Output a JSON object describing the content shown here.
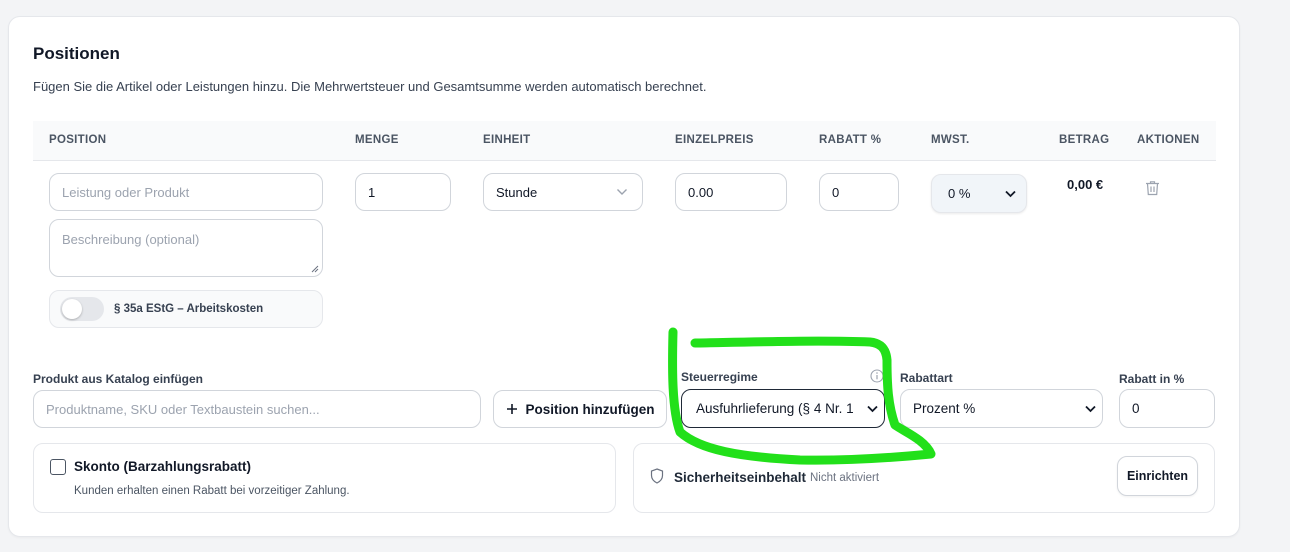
{
  "section": {
    "title": "Positionen",
    "subtitle": "Fügen Sie die Artikel oder Leistungen hinzu. Die Mehrwertsteuer und Gesamtsumme werden automatisch berechnet."
  },
  "table": {
    "headers": [
      "POSITION",
      "MENGE",
      "EINHEIT",
      "EINZELPREIS",
      "RABATT %",
      "MWST.",
      "BETRAG",
      "AKTIONEN"
    ],
    "row": {
      "position_placeholder": "Leistung oder Produkt",
      "beschreibung_placeholder": "Beschreibung (optional)",
      "menge": "1",
      "einheit": "Stunde",
      "einzelpreis": "0.00",
      "rabatt": "0",
      "mwst": "0 %",
      "betrag": "0,00 €",
      "toggle_label": "§ 35a EStG – Arbeitskosten",
      "toggle_on": false
    }
  },
  "catalog": {
    "label": "Produkt aus Katalog einfügen",
    "placeholder": "Produktname, SKU oder Textbaustein suchen...",
    "add_button": "Position hinzufügen"
  },
  "steuerregime": {
    "label": "Steuerregime",
    "value": "Ausfuhrlieferung (§ 4 Nr. 1"
  },
  "rabattart": {
    "label": "Rabattart",
    "value": "Prozent %"
  },
  "rabatt_prozent": {
    "label": "Rabatt in %",
    "value": "0"
  },
  "skonto": {
    "title": "Skonto (Barzahlungsrabatt)",
    "description": "Kunden erhalten einen Rabatt bei vorzeitiger Zahlung.",
    "checked": false
  },
  "sicherheitseinbehalt": {
    "title": "Sicherheitseinbehalt",
    "status": "Nicht aktiviert",
    "button": "Einrichten"
  },
  "colors": {
    "highlight": "#22e01a",
    "border": "#d1d5db",
    "text": "#111827"
  }
}
